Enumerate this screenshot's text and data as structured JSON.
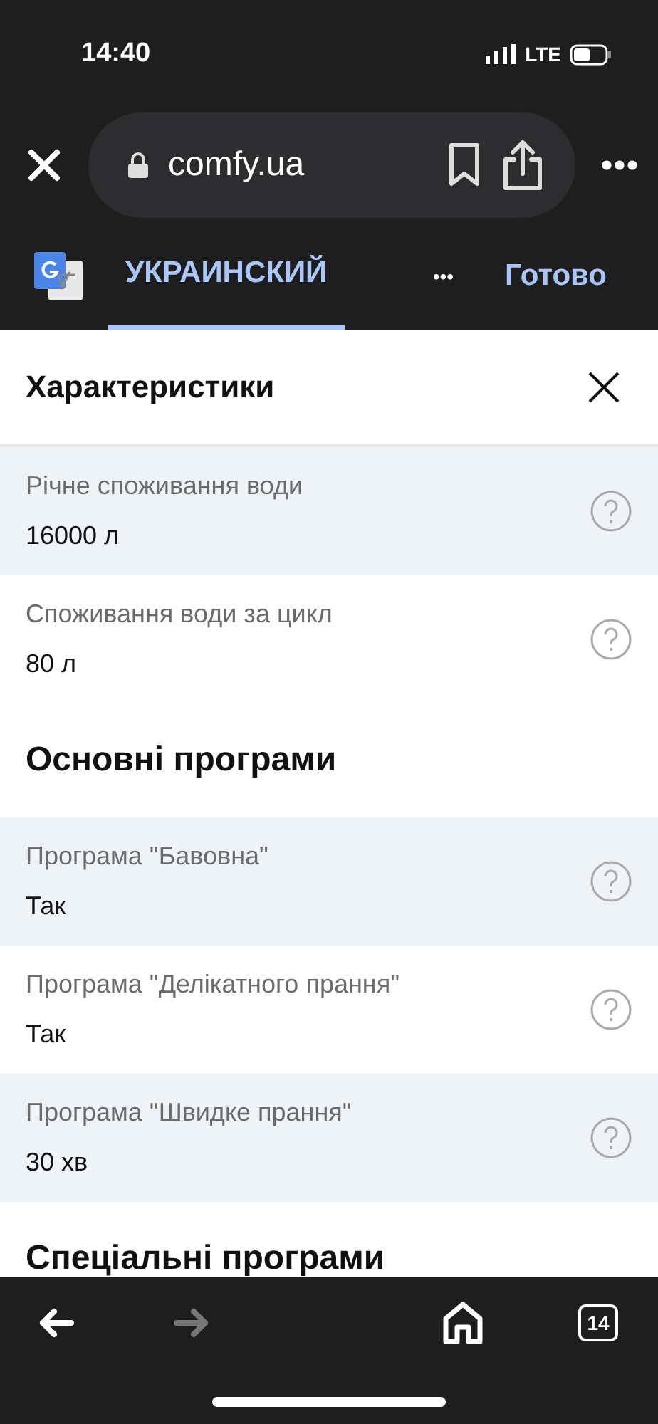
{
  "status_bar": {
    "time": "14:40",
    "network": "LTE"
  },
  "browser": {
    "url": "comfy.ua"
  },
  "translate_bar": {
    "language": "УКРАИНСКИЙ",
    "language_selected": true,
    "more": "•••",
    "done": "Готово"
  },
  "panel": {
    "title": "Характеристики",
    "sections": [
      {
        "rows": [
          {
            "label": "Річне споживання води",
            "value": "16000 л"
          },
          {
            "label": "Споживання води за цикл",
            "value": "80 л"
          }
        ]
      },
      {
        "heading": "Основні програми",
        "rows": [
          {
            "label": "Програма \"Бавовна\"",
            "value": "Так"
          },
          {
            "label": "Програма \"Делікатного прання\"",
            "value": "Так"
          },
          {
            "label": "Програма \"Швидке прання\"",
            "value": "30 хв"
          }
        ]
      },
      {
        "heading": "Спеціальні програми"
      }
    ]
  },
  "toolbar": {
    "back_disabled": false,
    "forward_disabled": true,
    "tabs_count": "14"
  }
}
